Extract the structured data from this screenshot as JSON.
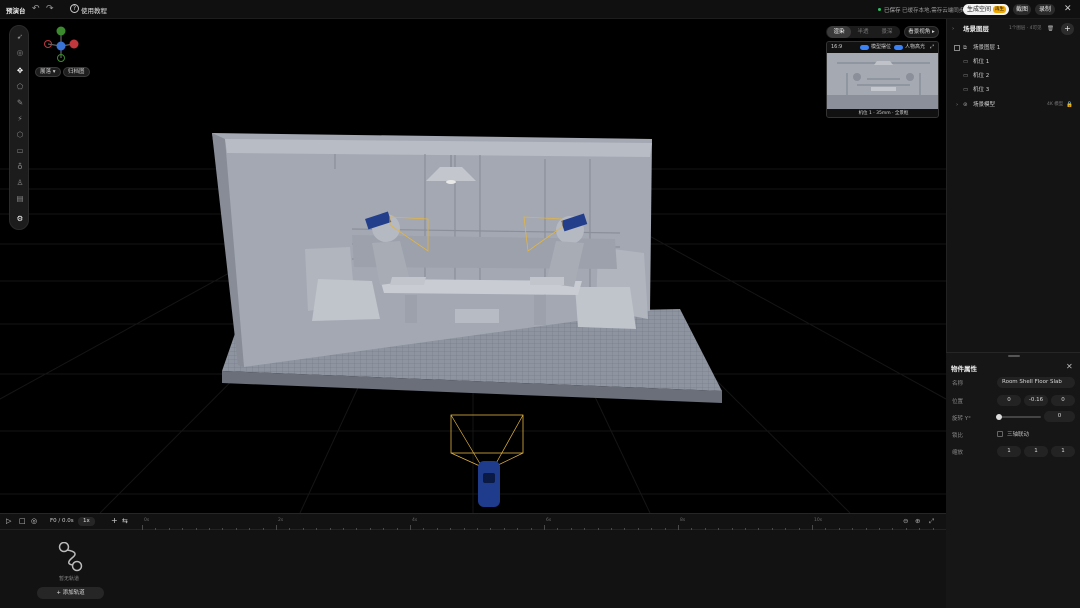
{
  "app": {
    "title": "预演台"
  },
  "topbar": {
    "undo_icon": "undo-icon",
    "redo_icon": "redo-icon",
    "tutorial_label": "使用教程",
    "save_status": "已保存",
    "save_note": "已缓存本地,需存云端同步",
    "generate_label": "生成空间",
    "generate_badge": "再生",
    "screenshot_label": "截图",
    "record_label": "录制",
    "close_icon": "close-icon"
  },
  "viewport": {
    "chip_expand": "展落",
    "chip_sketch": "归档图",
    "camera_tabs": [
      "渲染",
      "半透",
      "景深"
    ],
    "view_button": "看景视角",
    "preview": {
      "ratio": "16:9",
      "toggle_model_label": "模型摆位",
      "toggle_face_label": "人物高光",
      "caption": "机位 1 · 35mm · 全景框"
    }
  },
  "scene_panel": {
    "title": "场景图层",
    "meta": "1个图层 · 4可见",
    "items": [
      {
        "label": "场景图层 1",
        "icon": "layers-icon"
      },
      {
        "label": "机位 1",
        "icon": "camera-icon"
      },
      {
        "label": "机位 2",
        "icon": "camera-icon"
      },
      {
        "label": "机位 3",
        "icon": "camera-icon"
      },
      {
        "label": "场景模型",
        "icon": "cube-icon",
        "tag": "4K 模型"
      }
    ]
  },
  "properties": {
    "title": "物件属性",
    "name_label": "名称",
    "name_value": "Room Shell Floor Slab",
    "position_label": "位置",
    "position": {
      "x": "0",
      "y": "-0.16",
      "z": "0"
    },
    "rotation_label": "旋转 Y°",
    "rotation_value": "0",
    "rotation_fraction": 0,
    "lock_label": "锁比",
    "lock_option": "三轴联动",
    "scale_label": "缩放",
    "scale": {
      "x": "1",
      "y": "1",
      "z": "1"
    }
  },
  "timeline": {
    "time_display": "F0 / 0.0s",
    "speed": "1x",
    "ticks": [
      "0s",
      "2s",
      "4s",
      "6s",
      "8s",
      "10s"
    ],
    "empty_label": "暂无轨道",
    "add_track_label": "添加轨道"
  },
  "colors": {
    "accent": "#3b82f6",
    "bg": "#000000",
    "panel": "#141414",
    "camera_frustum": "#e3b441",
    "lock": "#e3a400"
  }
}
